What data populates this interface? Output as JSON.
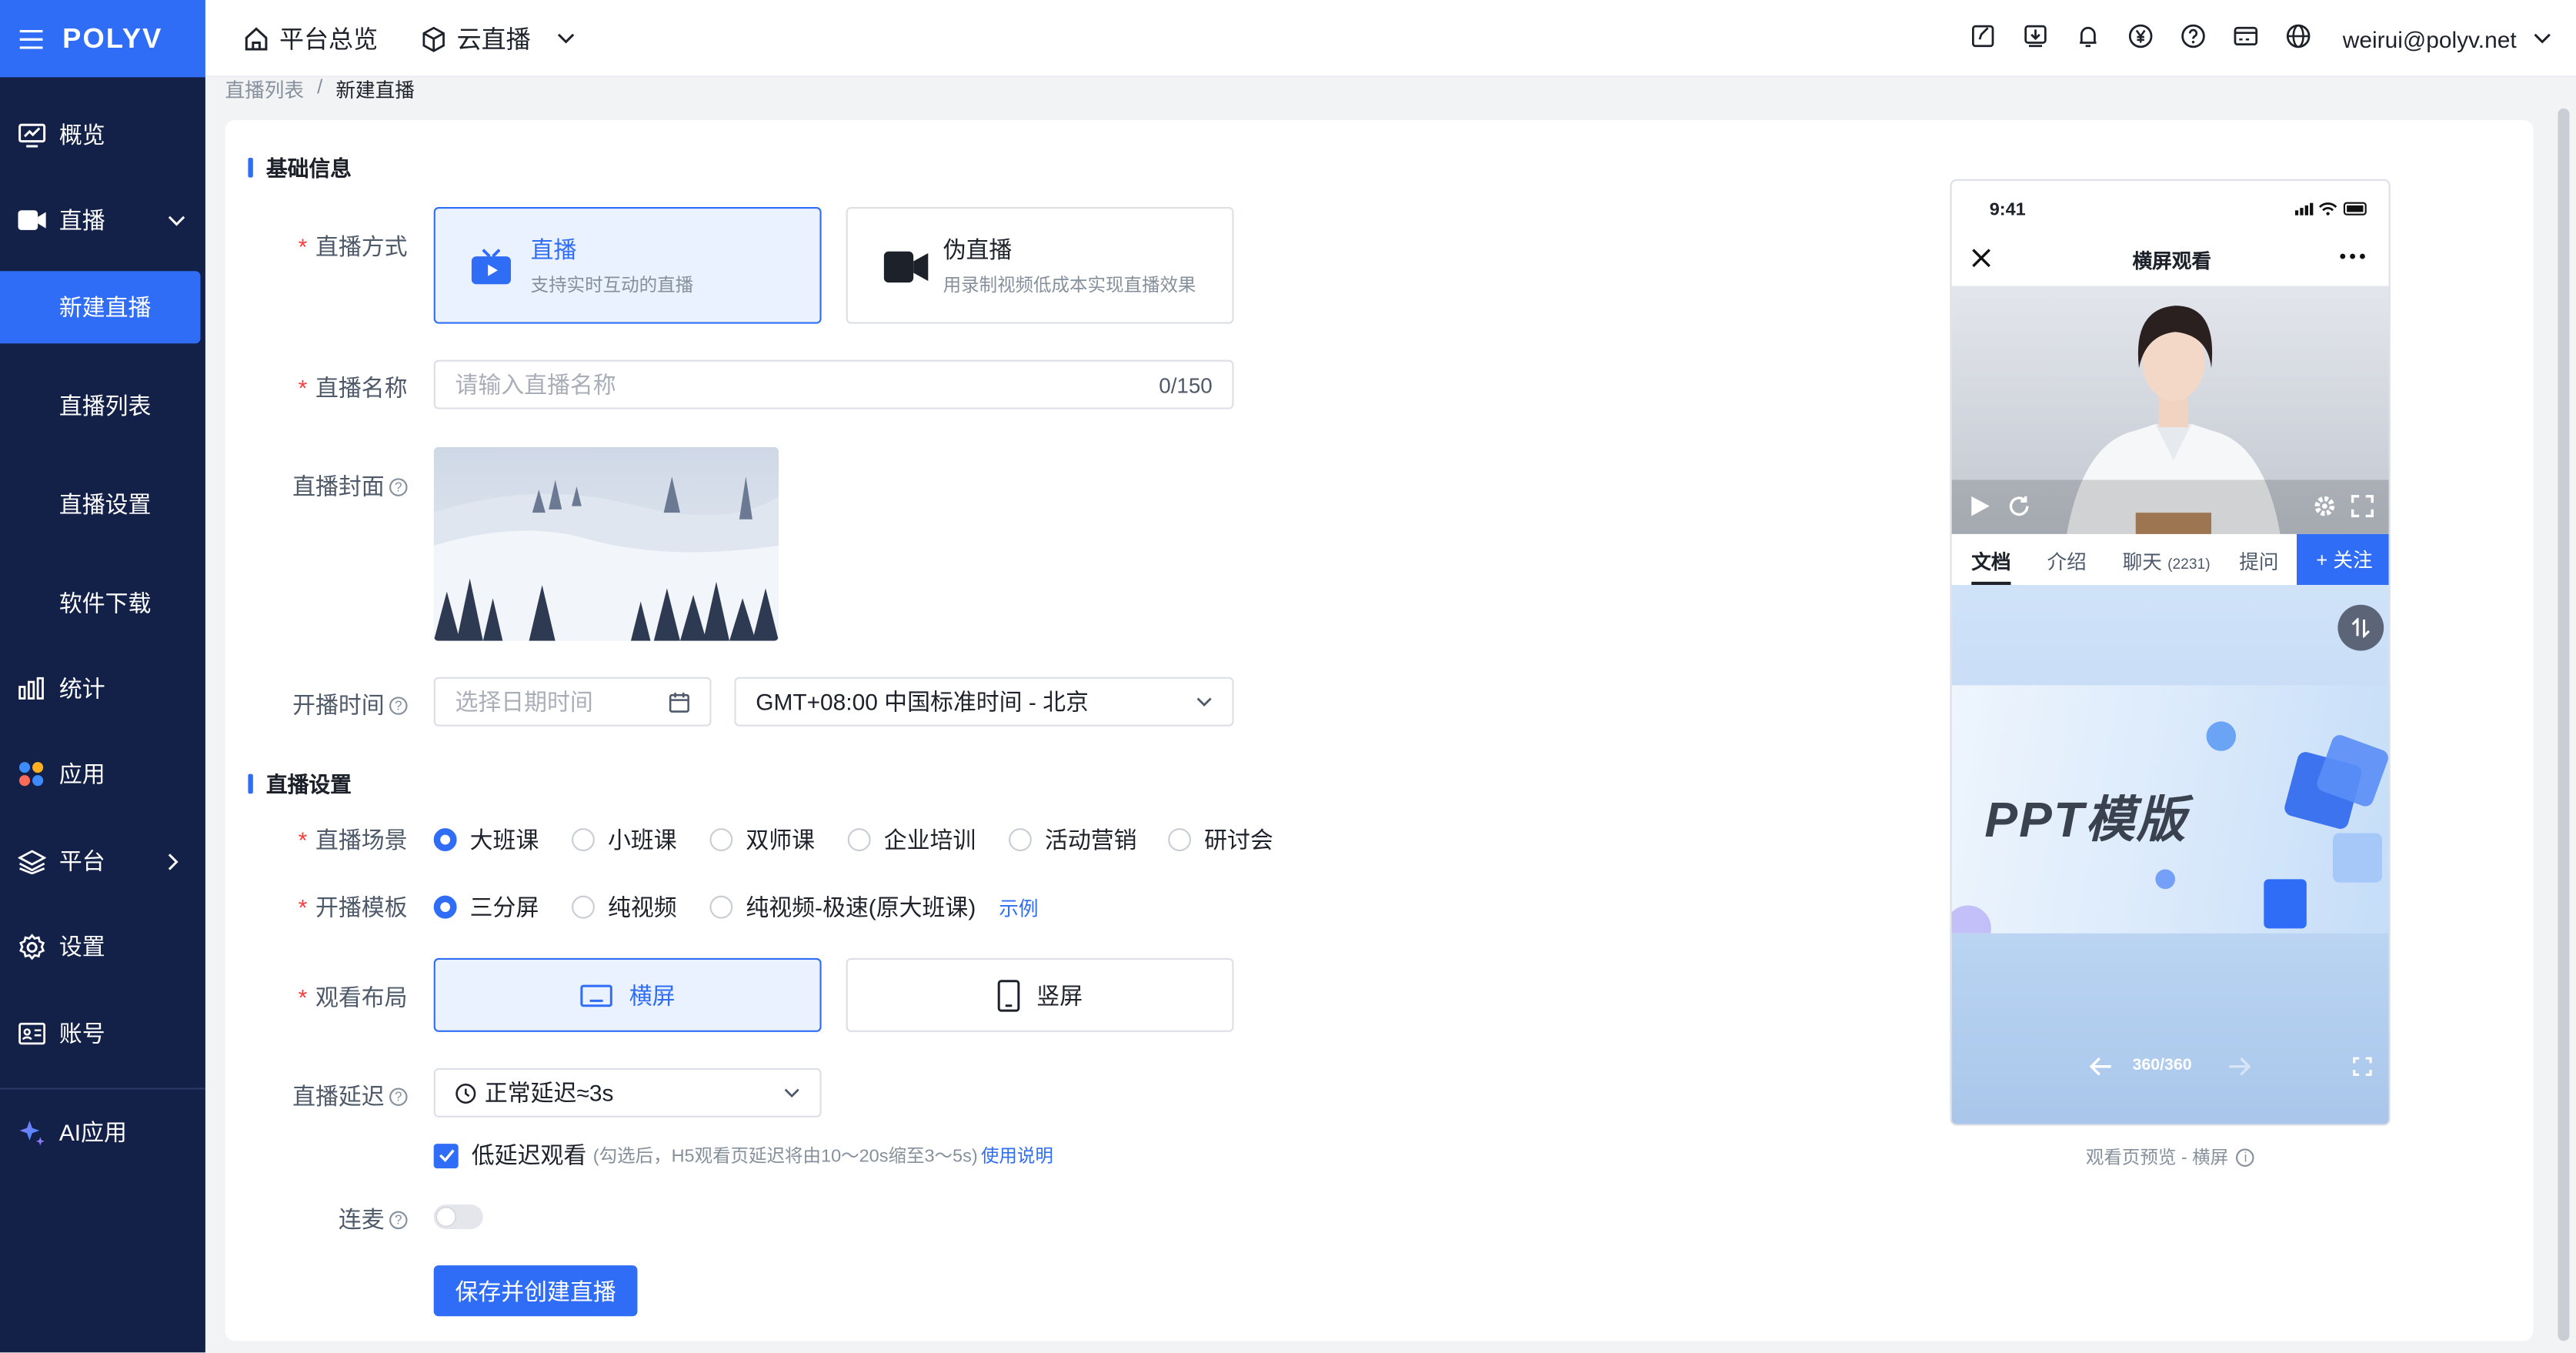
{
  "app": {
    "logo": "POLYV"
  },
  "sidebar": {
    "overview": "概览",
    "live": "直播",
    "live_sub": [
      "新建直播",
      "直播列表",
      "直播设置",
      "软件下载"
    ],
    "stats": "统计",
    "apps": "应用",
    "platform": "平台",
    "settings": "设置",
    "account": "账号",
    "ai": "AI应用"
  },
  "topbar": {
    "home": "平台总览",
    "product": "云直播",
    "user": "weirui@polyv.net",
    "icons": [
      "edit-icon",
      "download-icon",
      "bell-icon",
      "yuan-icon",
      "help-icon",
      "card-icon",
      "globe-icon"
    ]
  },
  "breadcrumb": {
    "parent": "直播列表",
    "sep": "/",
    "current": "新建直播"
  },
  "form": {
    "section_basic": "基础信息",
    "mode_label": "直播方式",
    "modes": [
      {
        "title": "直播",
        "desc": "支持实时互动的直播"
      },
      {
        "title": "伪直播",
        "desc": "用录制视频低成本实现直播效果"
      }
    ],
    "name_label": "直播名称",
    "name_placeholder": "请输入直播名称",
    "name_count": "0/150",
    "cover_label": "直播封面",
    "time_label": "开播时间",
    "time_placeholder": "选择日期时间",
    "timezone": "GMT+08:00 中国标准时间 - 北京",
    "section_settings": "直播设置",
    "scene_label": "直播场景",
    "scenes": [
      "大班课",
      "小班课",
      "双师课",
      "企业培训",
      "活动营销",
      "研讨会"
    ],
    "template_label": "开播模板",
    "templates": [
      "三分屏",
      "纯视频",
      "纯视频-极速(原大班课)"
    ],
    "template_example": "示例",
    "layout_label": "观看布局",
    "layouts": [
      "横屏",
      "竖屏"
    ],
    "delay_label": "直播延迟",
    "delay_value": "正常延迟≈3s",
    "low_latency_label": "低延迟观看",
    "low_latency_note": "(勾选后，H5观看页延迟将由10～20s缩至3～5s)",
    "low_latency_link": "使用说明",
    "mic_label": "连麦",
    "submit": "保存并创建直播"
  },
  "preview": {
    "time": "9:41",
    "title": "横屏观看",
    "tabs": [
      "文档",
      "介绍",
      "聊天",
      "提问"
    ],
    "chat_count": "(2231)",
    "follow": "+ 关注",
    "ppt_text": "PPT模版",
    "page": "360/360",
    "caption": "观看页预览 - 横屏"
  },
  "colors": {
    "primary": "#2f6df6",
    "sidebar": "#132148"
  }
}
